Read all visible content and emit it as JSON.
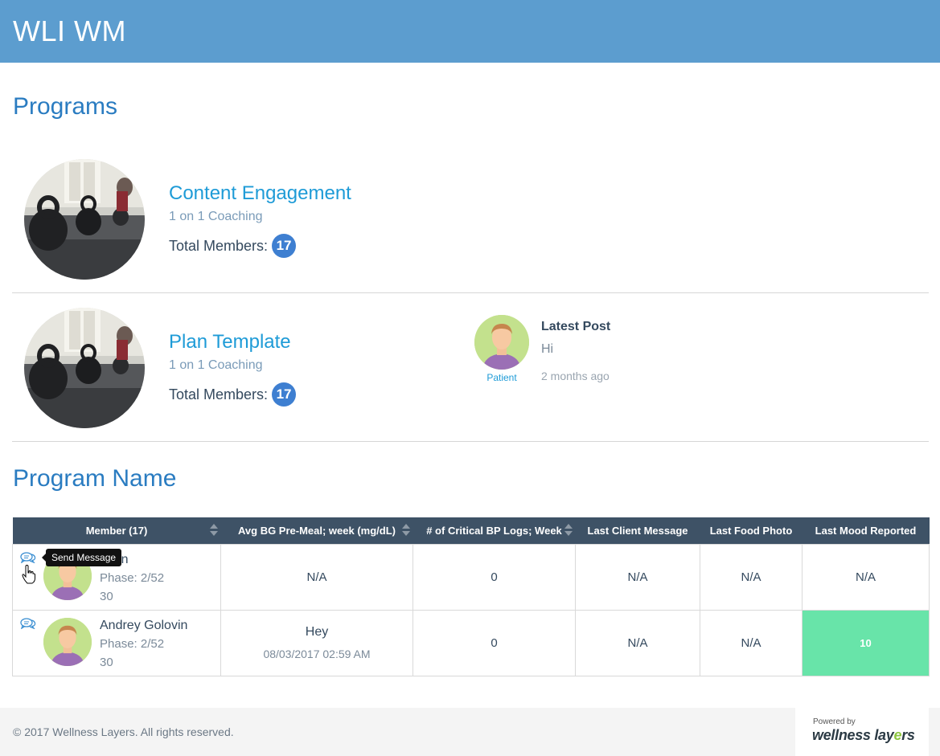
{
  "app": {
    "title": "WLI WM"
  },
  "programs_section": {
    "title": "Programs"
  },
  "programs": [
    {
      "name": "Content Engagement",
      "type": "1 on 1 Coaching",
      "total_label": "Total Members:",
      "total": "17"
    },
    {
      "name": "Plan Template",
      "type": "1 on 1 Coaching",
      "total_label": "Total Members:",
      "total": "17"
    }
  ],
  "latest_post": {
    "avatar_label": "Patient",
    "title": "Latest Post",
    "body": "Hi",
    "time": "2 months ago"
  },
  "program_name_section": {
    "title": "Program Name"
  },
  "table": {
    "columns": [
      "Member (17)",
      "Avg BG Pre-Meal; week (mg/dL)",
      "# of Critical BP Logs; Week",
      "Last Client Message",
      "Last Food Photo",
      "Last Mood Reported"
    ],
    "rows": [
      {
        "name": "Klein",
        "phase": "Phase: 2/52",
        "days": "30",
        "avg_bg": "N/A",
        "critical_bp": "0",
        "last_message": "N/A",
        "last_message_time": "",
        "last_food_photo": "N/A",
        "last_mood": "N/A"
      },
      {
        "name": "Andrey Golovin",
        "phase": "Phase: 2/52",
        "days": "30",
        "avg_bg": "",
        "critical_bp": "0",
        "last_message": "Hey",
        "last_message_time": "08/03/2017 02:59 AM",
        "last_food_photo": "N/A",
        "last_mood": "10"
      }
    ]
  },
  "tooltip": {
    "text": "Send Message"
  },
  "footer": {
    "copyright": "© 2017 Wellness Layers. All rights reserved.",
    "powered_by": "Powered by",
    "brand_main": "wellness lay",
    "brand_accent": "e",
    "brand_end": "rs"
  },
  "colors": {
    "header": "#5c9dcf",
    "accent": "#2a7cc1",
    "link": "#1e9bd7",
    "table_header": "#3e5266",
    "mood_good": "#68e4a9",
    "badge": "#3e7fd1"
  },
  "icons": {
    "message": "chat-bubbles-icon",
    "sort": "sort-icon",
    "cursor": "hand-cursor-icon"
  }
}
